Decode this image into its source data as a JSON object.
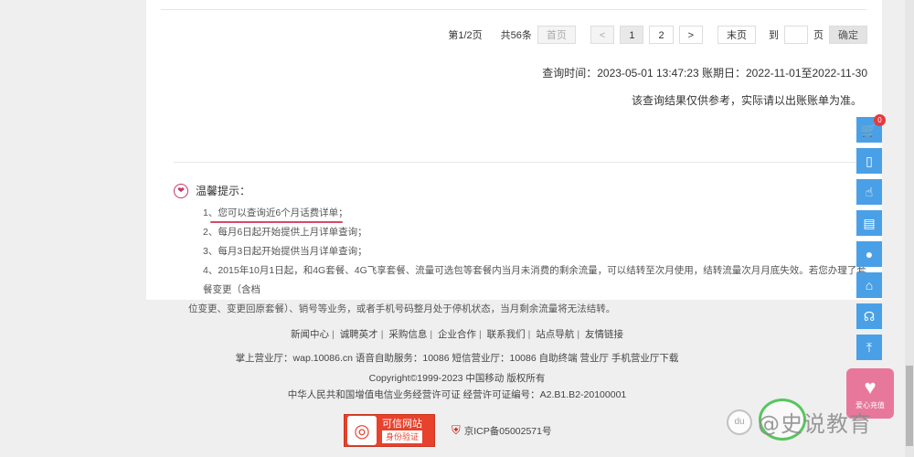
{
  "pagination": {
    "page_info": "第1/2页",
    "total_info": "共56条",
    "first_label": "首页",
    "prev_label": "<",
    "page1": "1",
    "page2": "2",
    "next_label": ">",
    "last_label": "末页",
    "goto_label": "到",
    "goto_value": "",
    "page_unit": "页",
    "confirm_label": "确定"
  },
  "query": {
    "line": "查询时间：2023-05-01 13:47:23 账期日：2022-11-01至2022-11-30",
    "disclaimer": "该查询结果仅供参考，实际请以出账账单为准。"
  },
  "tips": {
    "title": "温馨提示：",
    "items": [
      "1、您可以查询近6个月话费详单；",
      "2、每月6日起开始提供上月详单查询；",
      "3、每月3日起开始提供当月详单查询；",
      "4、2015年10月1日起，和4G套餐、4G飞享套餐、流量可选包等套餐内当月未消费的剩余流量，可以结转至次月使用，结转流量次月月底失效。若您办理了套餐变更（含档",
      "位变更、变更回原套餐）、销号等业务，或者手机号码整月处于停机状态，当月剩余流量将无法结转。"
    ]
  },
  "footer": {
    "links": [
      "新闻中心",
      "诚聘英才",
      "采购信息",
      "企业合作",
      "联系我们",
      "站点导航",
      "友情链接"
    ],
    "service_line": "掌上营业厅：wap.10086.cn 语音自助服务：10086 短信营业厅：10086 自助终端 营业厅 手机营业厅下载",
    "copyright": "Copyright©1999-2023  中国移动  版权所有",
    "license": "中华人民共和国增值电信业务经营许可证  经营许可证编号：A2.B1.B2-20100001",
    "badge_title": "可信网站",
    "badge_sub": "身份验证",
    "icp": "京ICP备05002571号"
  },
  "sidebar": {
    "cart_count": "0",
    "icons": [
      "cart-icon",
      "phone-icon",
      "hand-icon",
      "sim-card-icon",
      "user-icon",
      "home-icon",
      "headset-icon",
      "back-to-top-icon"
    ]
  },
  "recharge": {
    "label": "爱心充值"
  },
  "watermark": {
    "logo": "du",
    "text": "@史说教育"
  }
}
